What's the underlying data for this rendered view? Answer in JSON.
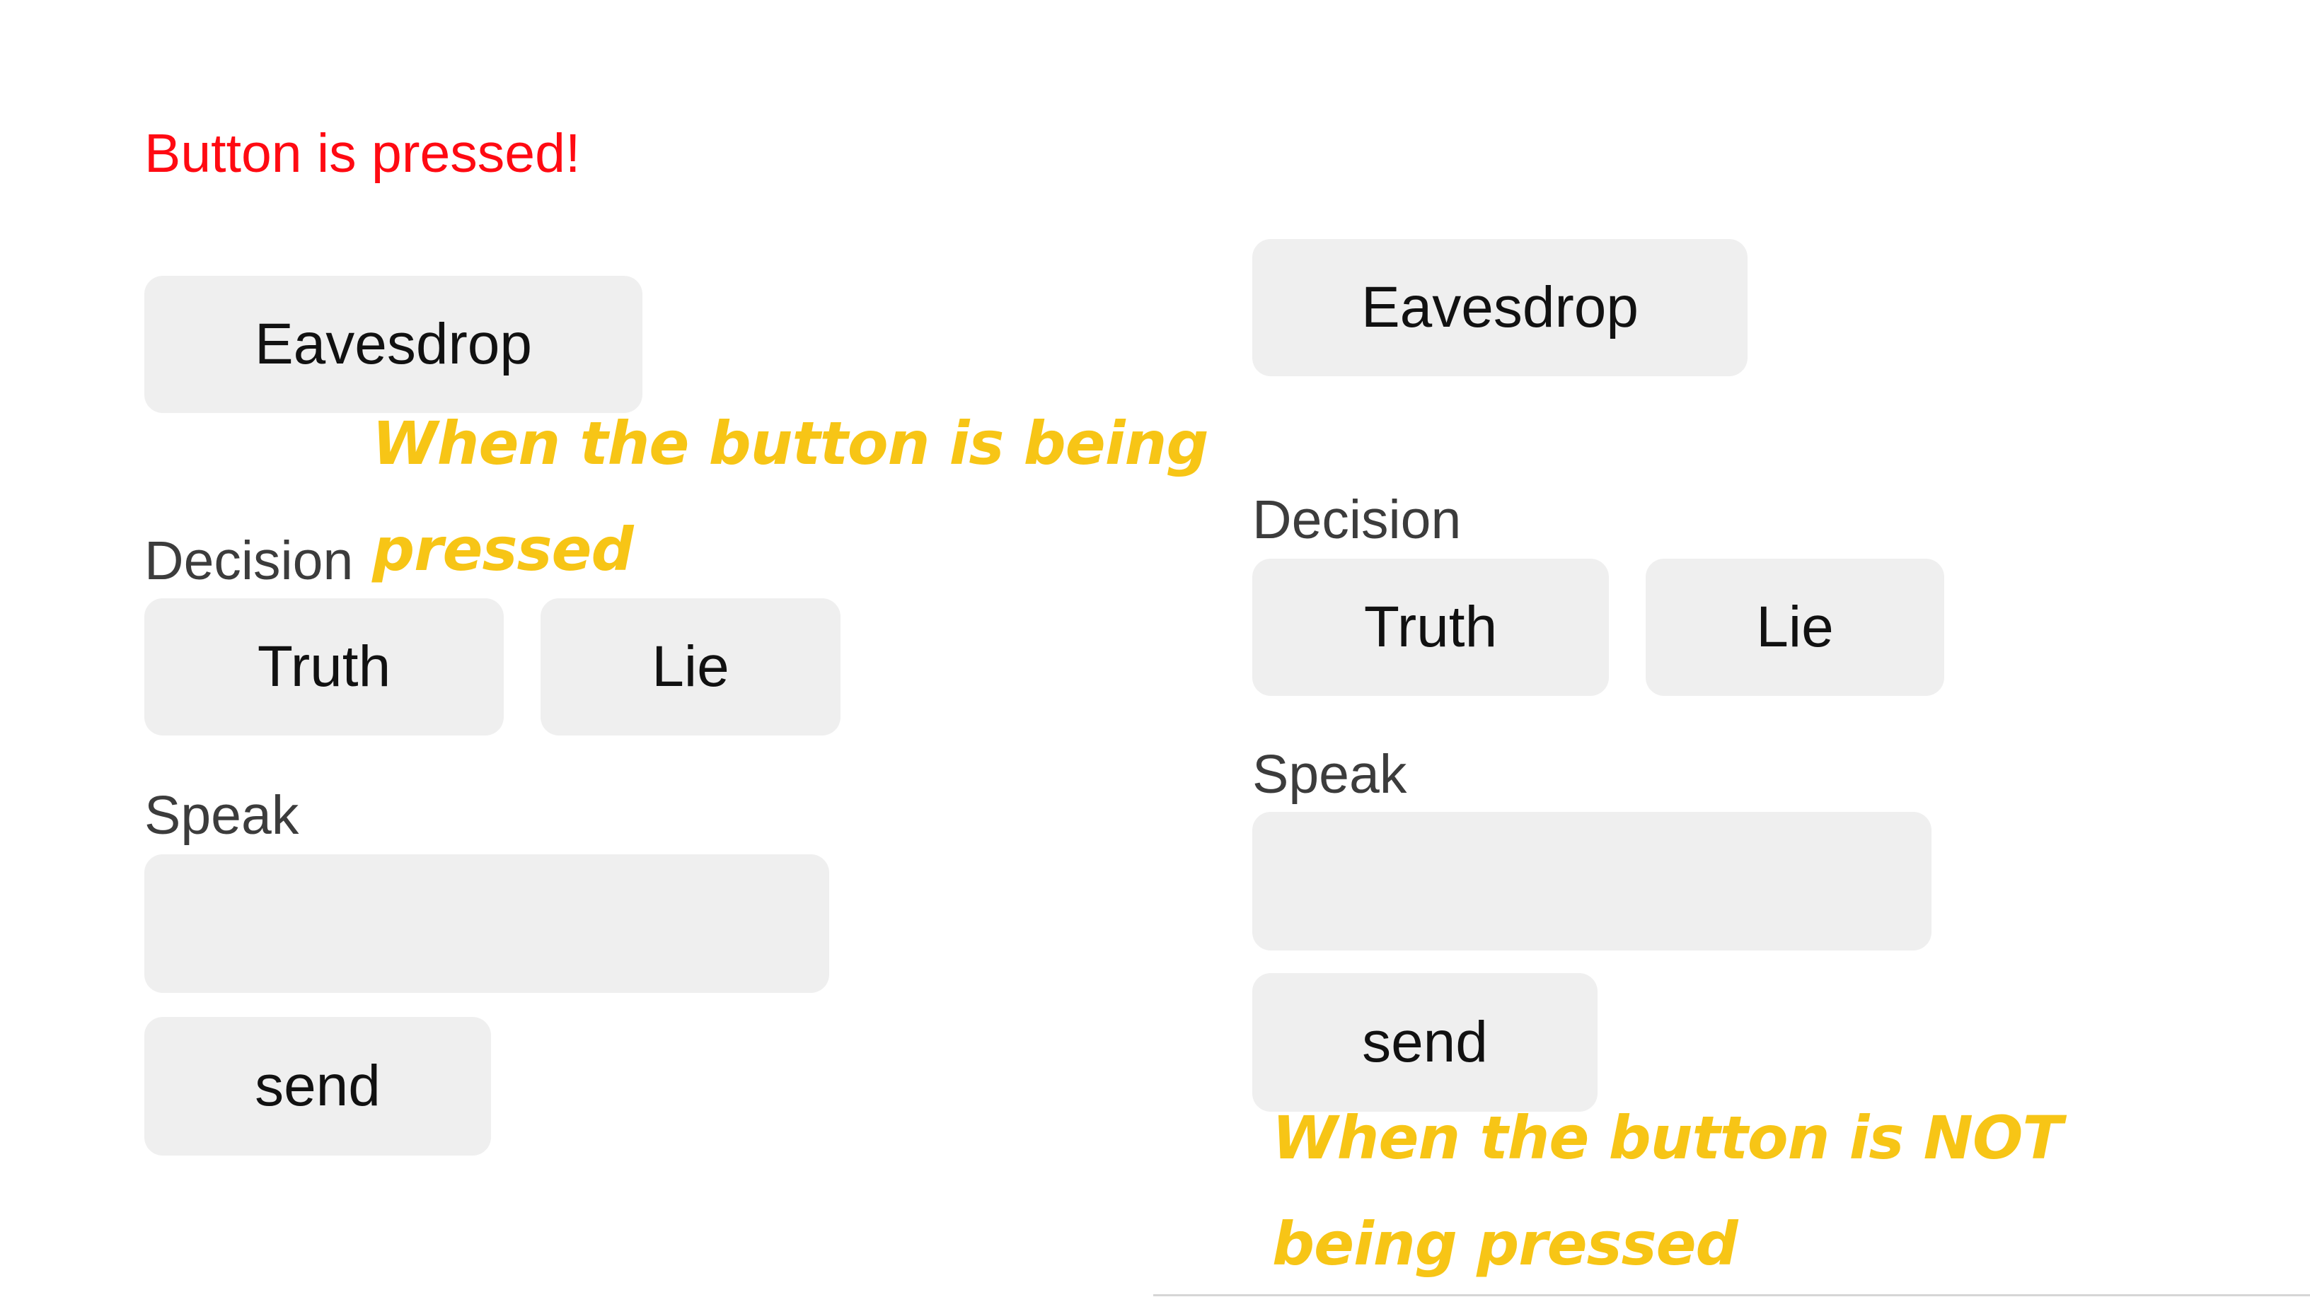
{
  "pressed_state": {
    "status_text": "Button is pressed!",
    "status_color": "#ff0a12",
    "eavesdrop_label": "Eavesdrop",
    "decision_label": "Decision",
    "truth_label": "Truth",
    "lie_label": "Lie",
    "speak_label": "Speak",
    "speak_value": "",
    "send_label": "send",
    "annotation_line1": "When the button is being",
    "annotation_line2": "pressed"
  },
  "not_pressed_state": {
    "eavesdrop_label": "Eavesdrop",
    "decision_label": "Decision",
    "truth_label": "Truth",
    "lie_label": "Lie",
    "speak_label": "Speak",
    "speak_value": "",
    "send_label": "send",
    "annotation_line1": "When the button is NOT",
    "annotation_line2": "being pressed"
  },
  "colors": {
    "button_bg": "#efefef",
    "annotation": "#f7c516",
    "label_text": "#3c3c3c"
  }
}
